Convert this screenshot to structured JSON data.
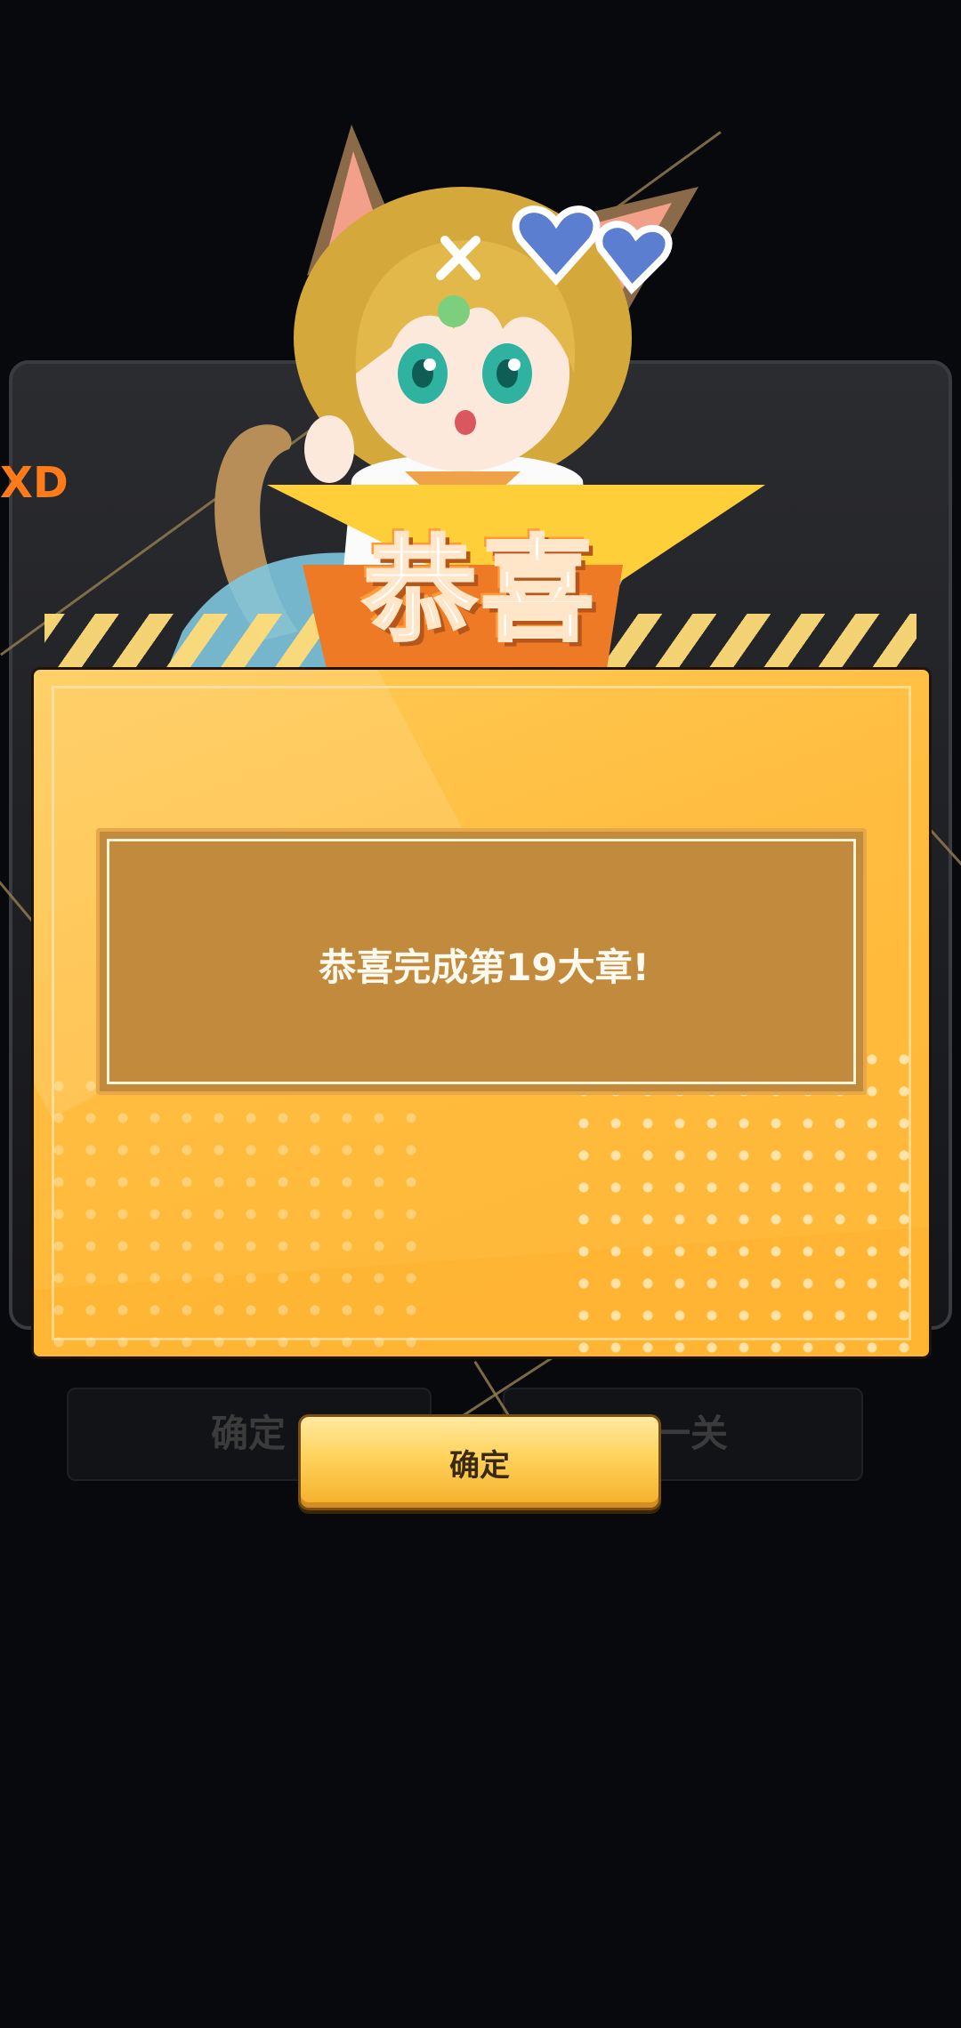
{
  "background": {
    "panel_title": "",
    "side_text": "XD",
    "left_button_label": "确定",
    "right_button_label": "一关"
  },
  "banner": {
    "title": "恭喜"
  },
  "dialog": {
    "message": "恭喜完成第19大章!"
  },
  "actions": {
    "confirm_label": "确定"
  },
  "icons": [
    "cat-girl-character",
    "stripe-band"
  ],
  "colors": {
    "dialog_yellow": "#ffbc3e",
    "message_box": "#c28a3c",
    "banner_orange": "#ef7a25",
    "button_gold": "#ffd25a"
  }
}
